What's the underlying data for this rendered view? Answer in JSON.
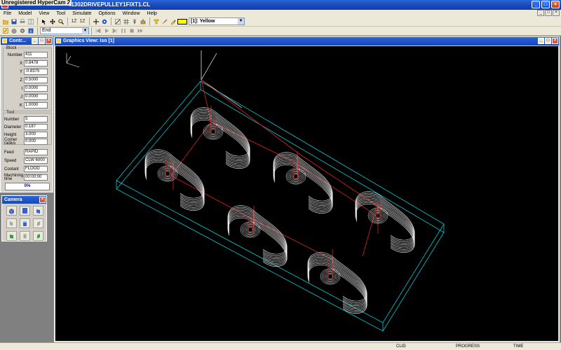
{
  "titlebar": {
    "overlay_text": "Unregistered HyperCam 2",
    "title": "- 41302DRIVEPULLEY1FIXT1.CL"
  },
  "menu": [
    "File",
    "Model",
    "View",
    "Tool",
    "Simulate",
    "Options",
    "Window",
    "Help"
  ],
  "toolbar": {
    "color_label": "[1]: Yellow",
    "color_hex": "#ffff00",
    "end_label": "End",
    "zoom_1": "1Z",
    "zoom_2": "1Z"
  },
  "controller": {
    "title": "Contr...",
    "block_group": "Block",
    "block": [
      {
        "label": "Number",
        "value": "411"
      },
      {
        "label": "X",
        "value": "0.8478"
      },
      {
        "label": "Y",
        "value": "-0.8375"
      },
      {
        "label": "Z",
        "value": "0.5000"
      },
      {
        "label": "I",
        "value": "0.0000"
      },
      {
        "label": "J",
        "value": "0.0000"
      },
      {
        "label": "K",
        "value": "1.0000"
      }
    ],
    "tool_group": "Tool",
    "tool": [
      {
        "label": "Number",
        "value": "5"
      },
      {
        "label": "Diameter",
        "value": "0.187"
      },
      {
        "label": "Height",
        "value": "3.000"
      },
      {
        "label": "Corner radius",
        "value": "0.000"
      }
    ],
    "other": [
      {
        "label": "Feed",
        "value": "RAPID"
      },
      {
        "label": "Speed",
        "value": "CLW 6000"
      },
      {
        "label": "Coolant",
        "value": "FLOOD"
      },
      {
        "label": "Machining time",
        "value": "00:00:00"
      }
    ],
    "progress": "0%"
  },
  "camera": {
    "title": "Camera",
    "views": [
      "iso-view-icon",
      "top-view-icon",
      "iso-right-icon",
      "left-view-icon",
      "front-view-icon",
      "right-view-icon",
      "back-left-icon",
      "back-view-icon",
      "back-right-icon"
    ]
  },
  "graphics": {
    "title": "Graphics View: Iso [1]"
  },
  "status": {
    "clid": "CLID",
    "progress": "PROGRESS",
    "time": "TIME"
  },
  "colors": {
    "stock_outline": "#00c8d0",
    "toolpath": "#ffffff",
    "rapid": "#e02020",
    "background": "#000000"
  }
}
